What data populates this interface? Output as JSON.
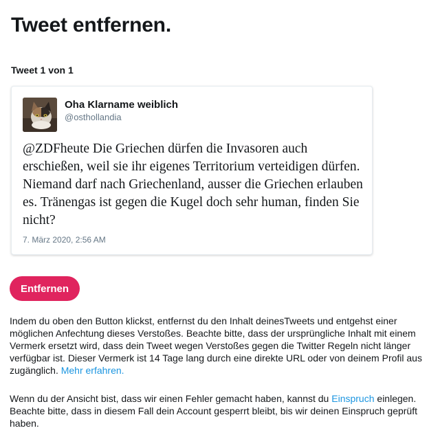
{
  "page": {
    "title": "Tweet entfernen.",
    "counter": "Tweet 1 von 1"
  },
  "tweet": {
    "author_name": "Oha Klarname weiblich",
    "author_handle": "@osthollandia",
    "avatar_icon": "cat-avatar",
    "text": "@ZDFheute Die Griechen dürfen die Invasoren auch erschießen, weil sie ihr eigenes Territorium verteidigen dürfen. Niemand darf nach Griechenland, ausser die Griechen erlauben es. Tränengas ist gegen die Kugel doch sehr human, finden Sie nicht?",
    "timestamp": "7. März 2020, 2:56 AM"
  },
  "actions": {
    "remove_label": "Entfernen",
    "remove_color": "#e0245e"
  },
  "info": {
    "paragraph1": "Indem du oben den Button klickst, entfernst du den Inhalt deinesTweets und entgehst einer möglichen Anfechtung dieses Verstoßes. Beachte bitte, dass der ursprüngliche Inhalt mit einem Vermerk ersetzt wird, dass dein Tweet wegen Verstoßes gegen die Twitter Regeln nicht länger verfügbar ist. Dieser Vermerk ist 14 Tage lang durch eine direkte URL oder von deinem Profil aus zugänglich.",
    "learn_more_link": "Mehr erfahren.",
    "paragraph2_before": "Wenn du der Ansicht bist, dass wir einen Fehler gemacht haben, kannst du",
    "appeal_link": "Einspruch",
    "paragraph2_after": "einlegen. Beachte bitte, dass in diesem Fall dein Account gesperrt bleibt, bis wir deinen Einspruch geprüft haben.",
    "link_color": "#1b95e0"
  }
}
